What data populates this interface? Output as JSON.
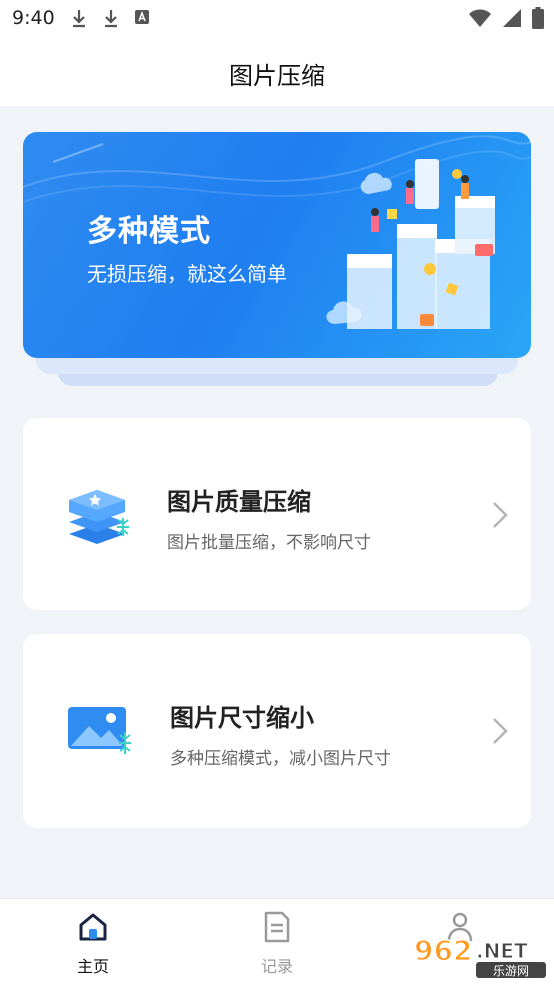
{
  "status_bar": {
    "time": "9:40",
    "icons_left": [
      "download-icon",
      "download-icon",
      "a-notification-icon"
    ],
    "icons_right": [
      "wifi-icon",
      "signal-icon",
      "battery-icon"
    ]
  },
  "header": {
    "title": "图片压缩"
  },
  "banner": {
    "title": "多种模式",
    "subtitle": "无损压缩，就这么简单"
  },
  "cards": [
    {
      "title": "图片质量压缩",
      "subtitle": "图片批量压缩，不影响尺寸",
      "icon": "layers-compress-icon"
    },
    {
      "title": "图片尺寸缩小",
      "subtitle": "多种压缩模式，减小图片尺寸",
      "icon": "image-resize-icon"
    }
  ],
  "tabs": [
    {
      "label": "主页",
      "icon": "home-icon",
      "active": true
    },
    {
      "label": "记录",
      "icon": "document-icon",
      "active": false
    },
    {
      "label": "",
      "icon": "user-icon",
      "active": false
    }
  ],
  "watermark": {
    "text": "962.NET",
    "sub": "乐游网"
  },
  "colors": {
    "accent": "#1f7ef1",
    "background": "#f0f3f8",
    "active_tab": "#111111",
    "inactive_tab": "#999999"
  }
}
